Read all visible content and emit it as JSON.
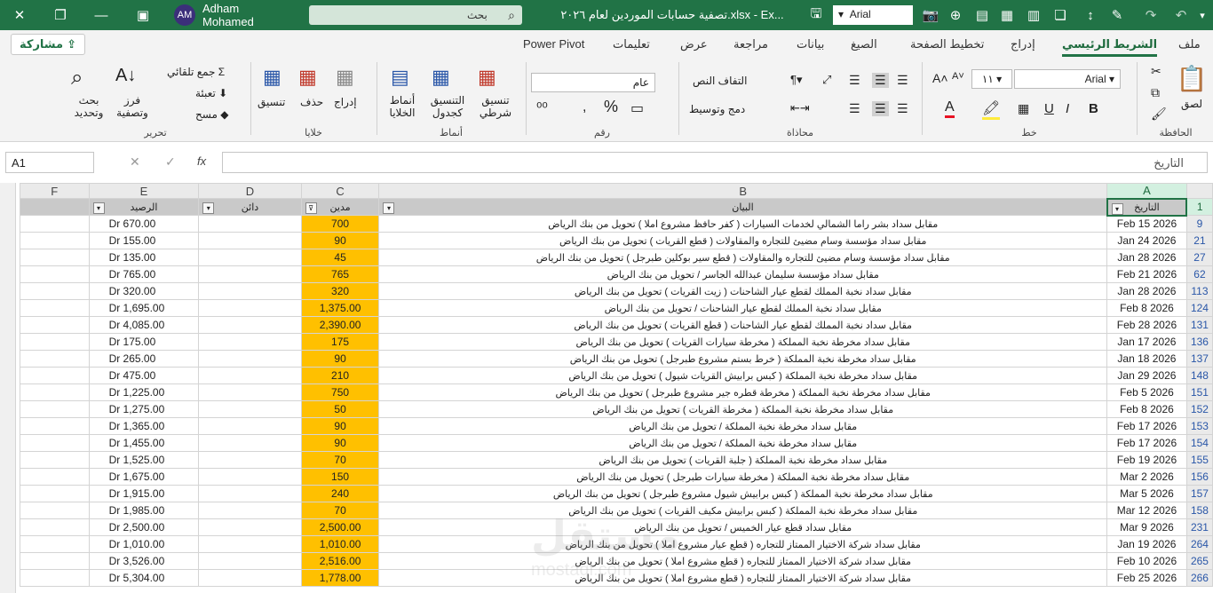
{
  "window": {
    "title": "تصفية حسابات الموردين لعام ٢٠٢٦.xlsx  -  Ex...",
    "search_placeholder": "بحث",
    "user_name": "Adham Mohamed",
    "user_initials": "AM",
    "font_value": "Arial"
  },
  "tabs": [
    "ملف",
    "الشريط الرئيسي",
    "إدراج",
    "تخطيط الصفحة",
    "الصيغ",
    "بيانات",
    "مراجعة",
    "عرض",
    "تعليمات",
    "Power Pivot"
  ],
  "share_label": "مشاركة",
  "ribbon": {
    "clipboard": {
      "label": "الحافظة",
      "paste": "لصق"
    },
    "font": {
      "label": "خط",
      "name": "Arial",
      "size": "١١",
      "bold": "B",
      "italic": "I",
      "underline": "U"
    },
    "alignment": {
      "label": "محاذاة",
      "wrap": "التفاف النص",
      "merge": "دمج وتوسيط"
    },
    "number": {
      "label": "رقم",
      "format": "عام",
      "percent": "%"
    },
    "styles": {
      "label": "أنماط",
      "conditional": "تنسيق شرطي",
      "as_table": "التنسيق كجدول",
      "cell_styles": "أنماط الخلايا"
    },
    "cells": {
      "label": "خلايا",
      "insert": "إدراج",
      "delete": "حذف",
      "format": "تنسيق"
    },
    "editing": {
      "label": "تحرير",
      "autosum": "جمع تلقائي",
      "fill": "تعبئة",
      "clear": "مسح",
      "sort": "فرز وتصفية",
      "find": "بحث وتحديد"
    }
  },
  "formula_bar": {
    "name_box": "A1",
    "fx": "fx",
    "value": "التاريخ"
  },
  "columns": [
    "A",
    "B",
    "C",
    "D",
    "E",
    "F"
  ],
  "headers": {
    "date": "التاريخ",
    "desc": "البيان",
    "debit": "مدين",
    "credit": "دائن",
    "balance": "الرصيد"
  },
  "rows": [
    {
      "n": "1",
      "date": "",
      "desc": "",
      "debit": "",
      "balance": ""
    },
    {
      "n": "9",
      "date": "Feb 15 2026",
      "desc": "مقابل سداد بشر راما الشمالي لخدمات السيارات ( كفر حافظ مشروع املا ) تحويل من بنك الرياض",
      "debit": "700",
      "balance": "Dr  670.00"
    },
    {
      "n": "21",
      "date": "Jan 24 2026",
      "desc": "مقابل سداد مؤسسة وسام مضيئ للتجاره والمقاولات ( قطع القريات ) تحويل من بنك الرياض",
      "debit": "90",
      "balance": "Dr  155.00"
    },
    {
      "n": "27",
      "date": "Jan 28 2026",
      "desc": "مقابل سداد مؤسسة وسام مضيئ للتجاره والمقاولات ( قطع سير بوكلين طبرجل ) تحويل من بنك الرياض",
      "debit": "45",
      "balance": "Dr  135.00"
    },
    {
      "n": "62",
      "date": "Feb 21 2026",
      "desc": "مقابل سداد مؤسسة سليمان عبدالله الجاسر / تحويل من بنك الرياض",
      "debit": "765",
      "balance": "Dr  765.00"
    },
    {
      "n": "113",
      "date": "Jan 28 2026",
      "desc": "مقابل سداد نخبة المملك لقطع عيار الشاحنات ( زيت القريات ) تحويل من بنك الرياض",
      "debit": "320",
      "balance": "Dr  320.00"
    },
    {
      "n": "124",
      "date": "Feb  8 2026",
      "desc": "مقابل سداد نخبة المملك لقطع عيار الشاحنات / تحويل من بنك الرياض",
      "debit": "1,375.00",
      "balance": "Dr  1,695.00"
    },
    {
      "n": "131",
      "date": "Feb 28 2026",
      "desc": "مقابل سداد نخبة المملك لقطع عيار الشاحنات ( قطع القريات ) تحويل من بنك الرياض",
      "debit": "2,390.00",
      "balance": "Dr  4,085.00"
    },
    {
      "n": "136",
      "date": "Jan 17 2026",
      "desc": "مقابل سداد مخرطة نخبة المملكة ( مخرطة سيارات القريات ) تحويل من بنك الرياض",
      "debit": "175",
      "balance": "Dr  175.00"
    },
    {
      "n": "137",
      "date": "Jan 18 2026",
      "desc": "مقابل سداد مخرطة نخبة المملكة ( خرط بستم مشروع طبرجل ) تحويل من بنك الرياض",
      "debit": "90",
      "balance": "Dr  265.00"
    },
    {
      "n": "148",
      "date": "Jan 29 2026",
      "desc": "مقابل سداد مخرطة نخبة المملكة ( كبس برابيش القريات شيول ) تحويل من بنك الرياض",
      "debit": "210",
      "balance": "Dr  475.00"
    },
    {
      "n": "151",
      "date": "Feb  5 2026",
      "desc": "مقابل سداد مخرطة نخبة المملكة ( مخرطة قطره جير مشروع طبرجل ) تحويل من بنك الرياض",
      "debit": "750",
      "balance": "Dr  1,225.00"
    },
    {
      "n": "152",
      "date": "Feb  8 2026",
      "desc": "مقابل سداد مخرطة نخبة المملكة ( مخرطة القريات ) تحويل من بنك الرياض",
      "debit": "50",
      "balance": "Dr  1,275.00"
    },
    {
      "n": "153",
      "date": "Feb 17 2026",
      "desc": "مقابل سداد مخرطة نخبة المملكة / تحويل من بنك الرياض",
      "debit": "90",
      "balance": "Dr  1,365.00"
    },
    {
      "n": "154",
      "date": "Feb 17 2026",
      "desc": "مقابل سداد مخرطة نخبة المملكة / تحويل من بنك الرياض",
      "debit": "90",
      "balance": "Dr  1,455.00"
    },
    {
      "n": "155",
      "date": "Feb 19 2026",
      "desc": "مقابل سداد مخرطة نخبة المملكة ( جلبة القريات ) تحويل من بنك الرياض",
      "debit": "70",
      "balance": "Dr  1,525.00"
    },
    {
      "n": "156",
      "date": "Mar  2 2026",
      "desc": "مقابل سداد مخرطة نخبة المملكة ( مخرطة سيارات طبرجل ) تحويل من بنك الرياض",
      "debit": "150",
      "balance": "Dr  1,675.00"
    },
    {
      "n": "157",
      "date": "Mar  5 2026",
      "desc": "مقابل سداد مخرطة نخبة المملكة ( كبس برابيش شيول مشروع طبرجل ) تحويل من بنك الرياض",
      "debit": "240",
      "balance": "Dr  1,915.00"
    },
    {
      "n": "158",
      "date": "Mar 12 2026",
      "desc": "مقابل سداد مخرطة نخبة المملكة ( كبس برابيش مكيف القريات ) تحويل من بنك الرياض",
      "debit": "70",
      "balance": "Dr  1,985.00"
    },
    {
      "n": "231",
      "date": "Mar  9 2026",
      "desc": "مقابل سداد قطع عيار الخميس / تحويل من بنك الرياض",
      "debit": "2,500.00",
      "balance": "Dr  2,500.00"
    },
    {
      "n": "264",
      "date": "Jan 19 2026",
      "desc": "مقابل سداد شركة الاختيار الممتاز للتجاره ( قطع عيار مشروع املا ) تحويل من بنك الرياض",
      "debit": "1,010.00",
      "balance": "Dr  1,010.00"
    },
    {
      "n": "265",
      "date": "Feb 10 2026",
      "desc": "مقابل سداد شركة الاختيار الممتاز للتجاره ( قطع مشروع املا ) تحويل من بنك الرياض",
      "debit": "2,516.00",
      "balance": "Dr  3,526.00"
    },
    {
      "n": "266",
      "date": "Feb 25 2026",
      "desc": "مقابل سداد شركة الاختيار الممتاز للتجاره ( قطع مشروع املا ) تحويل من بنك الرياض",
      "debit": "1,778.00",
      "balance": "Dr  5,304.00"
    }
  ],
  "watermark": {
    "main": "مستقل",
    "sub": "mostaql.com"
  },
  "colors": {
    "brand": "#217346",
    "debit_fill": "#ffc000",
    "header_fill": "#c9c9c9"
  }
}
